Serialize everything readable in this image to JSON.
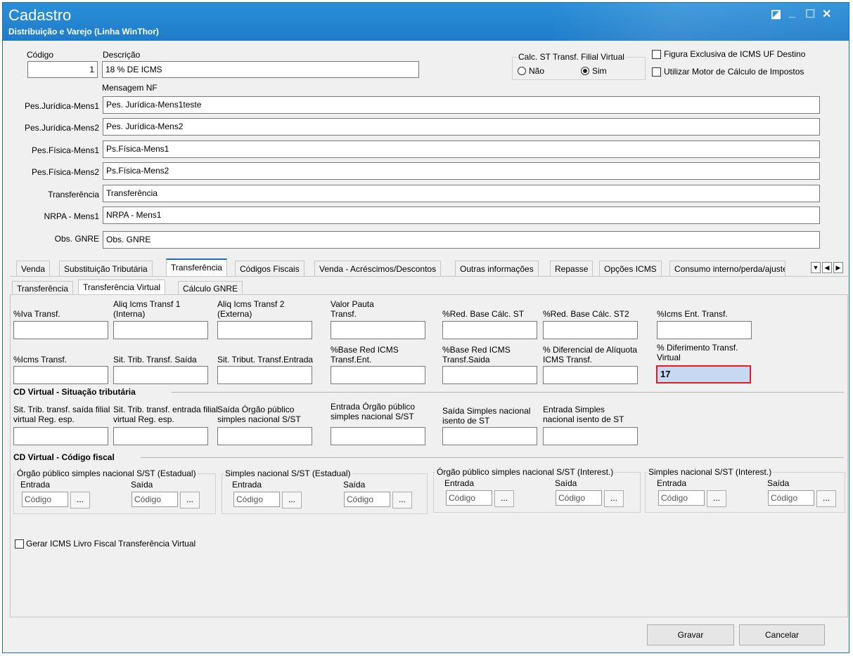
{
  "window": {
    "title": "Cadastro",
    "subtitle": "Distribuição e Varejo (Linha WinThor)"
  },
  "header": {
    "codigo_label": "Código",
    "codigo_value": "1",
    "descricao_label": "Descrição",
    "descricao_value": "18 % DE ICMS",
    "calc_st_label": "Calc. ST Transf. Filial Virtual",
    "radio_nao": "Não",
    "radio_sim": "Sim",
    "chk_figura": "Figura Exclusiva de ICMS UF Destino",
    "chk_motor": "Utilizar Motor de Cálculo de Impostos",
    "mensagem_nf": "Mensagem NF"
  },
  "messages": [
    {
      "label": "Pes.Jurídica-Mens1",
      "value": "Pes. Jurídica-Mens1teste"
    },
    {
      "label": "Pes.Jurídica-Mens2",
      "value": "Pes. Jurídica-Mens2"
    },
    {
      "label": "Pes.Física-Mens1",
      "value": "Ps.Física-Mens1"
    },
    {
      "label": "Pes.Física-Mens2",
      "value": "Ps.Física-Mens2"
    },
    {
      "label": "Transferência",
      "value": "Transferência"
    },
    {
      "label": "NRPA - Mens1",
      "value": "NRPA - Mens1"
    },
    {
      "label": "Obs. GNRE",
      "value": "Obs. GNRE"
    }
  ],
  "tabs": [
    "Venda",
    "Substituição Tributária",
    "Transferência",
    "Códigos Fiscais",
    "Venda - Acréscimos/Descontos",
    "Outras informações",
    "Repasse",
    "Opções ICMS",
    "Consumo interno/perda/ajuste"
  ],
  "subtabs": [
    "Transferência",
    "Transferência Virtual",
    "Cálculo GNRE"
  ],
  "row1": [
    {
      "label": "%Iva Transf.",
      "value": ""
    },
    {
      "label": "Aliq Icms Transf 1 (Interna)",
      "value": ""
    },
    {
      "label": "Aliq Icms Transf 2 (Externa)",
      "value": ""
    },
    {
      "label": "Valor Pauta Transf.",
      "value": ""
    },
    {
      "label": "%Red. Base Cálc. ST",
      "value": ""
    },
    {
      "label": "%Red. Base Cálc. ST2",
      "value": ""
    },
    {
      "label": "%Icms Ent. Transf.",
      "value": ""
    }
  ],
  "row2": [
    {
      "label": "%Icms Transf.",
      "value": ""
    },
    {
      "label": "Sit. Trib. Transf. Saída",
      "value": ""
    },
    {
      "label": "Sit. Tribut. Transf.Entrada",
      "value": ""
    },
    {
      "label": "%Base Red ICMS Transf.Ent.",
      "value": ""
    },
    {
      "label": "%Base Red ICMS Transf.Saida",
      "value": ""
    },
    {
      "label": "% Diferencial de Alíquota ICMS Transf.",
      "value": ""
    },
    {
      "label": "% Diferimento Transf. Virtual",
      "value": "17"
    }
  ],
  "cd_sit": {
    "title": "CD Virtual - Situação tributária",
    "fields": [
      {
        "label": "Sit. Trib. transf. saída filial virtual Reg. esp.",
        "value": ""
      },
      {
        "label": "Sit. Trib. transf. entrada filial virtual Reg. esp.",
        "value": ""
      },
      {
        "label": "Saída Órgão público simples nacional S/ST",
        "value": ""
      },
      {
        "label": "Entrada Órgão público simples nacional S/ST",
        "value": ""
      },
      {
        "label": "Saída Simples nacional isento de ST",
        "value": ""
      },
      {
        "label": "Entrada Simples nacional isento de ST",
        "value": ""
      }
    ]
  },
  "cd_cfop": {
    "title": "CD Virtual - Código fiscal",
    "groups": [
      "Órgão público simples nacional S/ST (Estadual)",
      "Simples nacional S/ST (Estadual)",
      "Órgão público simples nacional S/ST (Interest.)",
      "Simples nacional S/ST (Interest.)"
    ],
    "entrada": "Entrada",
    "saida": "Saída",
    "code_placeholder": "Código",
    "dots": "..."
  },
  "gerar_icms": "Gerar ICMS Livro Fiscal Transferência Virtual",
  "buttons": {
    "gravar": "Gravar",
    "cancelar": "Cancelar"
  }
}
